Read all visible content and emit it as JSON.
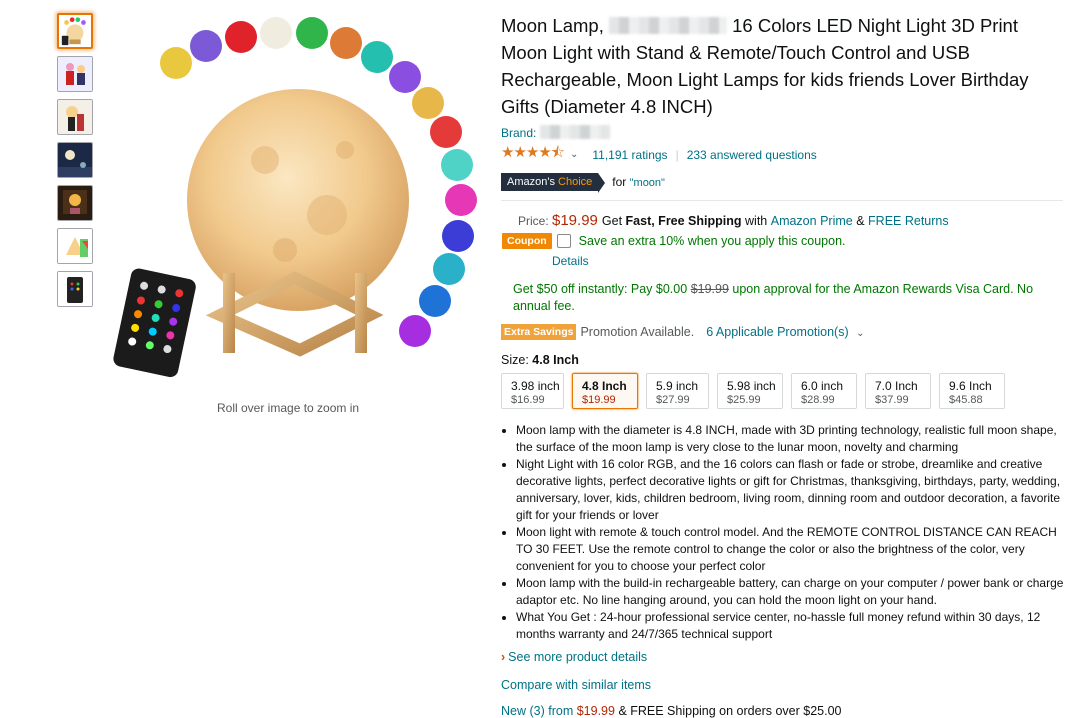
{
  "product": {
    "title_part1": "Moon Lamp,",
    "title_part2": "16 Colors LED Night Light 3D Print Moon Light with Stand & Remote/Touch Control and USB Rechargeable, Moon Light Lamps for kids friends Lover Birthday Gifts (Diameter 4.8 INCH)",
    "brand_label": "Brand:",
    "rating_stars": "★★★★⯪",
    "ratings_count": "11,191 ratings",
    "answered_questions": "233 answered questions",
    "choice_badge_1": "Amazon's",
    "choice_badge_2": "Choice",
    "choice_for": "for",
    "choice_query": "\"moon\""
  },
  "gallery": {
    "zoom_hint": "Roll over image to zoom in",
    "thumbnail_count": 7
  },
  "price": {
    "label": "Price:",
    "amount": "$19.99",
    "get": "Get",
    "shipping": "Fast, Free Shipping",
    "with": "with",
    "prime": "Amazon Prime",
    "amp": "&",
    "returns": "FREE Returns"
  },
  "coupon": {
    "tag": "Coupon",
    "text": "Save an extra 10% when you apply this coupon.",
    "details": "Details"
  },
  "visa": {
    "text_1": "Get $50 off instantly: Pay $0.00",
    "strike": "$19.99",
    "text_2": "upon approval for the Amazon Rewards Visa Card. No annual fee."
  },
  "promo": {
    "tag": "Extra Savings",
    "available": "Promotion Available.",
    "link": "6 Applicable Promotion(s)"
  },
  "size": {
    "label": "Size:",
    "selected": "4.8 Inch",
    "options": [
      {
        "name": "3.98 inch",
        "price": "$16.99"
      },
      {
        "name": "4.8 Inch",
        "price": "$19.99"
      },
      {
        "name": "5.9 inch",
        "price": "$27.99"
      },
      {
        "name": "5.98 inch",
        "price": "$25.99"
      },
      {
        "name": "6.0 inch",
        "price": "$28.99"
      },
      {
        "name": "7.0 Inch",
        "price": "$37.99"
      },
      {
        "name": "9.6 Inch",
        "price": "$45.88"
      }
    ]
  },
  "bullets": [
    "Moon lamp with the diameter is 4.8 INCH, made with 3D printing technology, realistic full moon shape, the surface of the moon lamp is very close to the lunar moon, novelty and charming",
    "Night Light with 16 color RGB, and the 16 colors can flash or fade or strobe, dreamlike and creative decorative lights, perfect decorative lights or gift for Christmas, thanksgiving, birthdays, party, wedding, anniversary, lover, kids, children bedroom, living room, dinning room and outdoor decoration, a favorite gift for your friends or lover",
    "Moon light with remote & touch control model. And the REMOTE CONTROL DISTANCE CAN REACH TO 30 FEET. Use the remote control to change the color or also the brightness of the color, very convenient for you to choose your perfect color",
    "Moon lamp with the build-in rechargeable battery, can charge on your computer / power bank or charge adaptor etc. No line hanging around, you can hold the moon light on your hand.",
    "What You Get : 24-hour professional service center, no-hassle full money refund within 30 days, 12 months warranty and 24/7/365 technical support"
  ],
  "links": {
    "see_more": "See more product details",
    "compare": "Compare with similar items",
    "new_offers": "New (3) from",
    "new_price": "$19.99",
    "new_shipping": "& FREE Shipping on orders over $25.00"
  },
  "colors": {
    "link": "#007185",
    "price": "#B12704",
    "green": "#007600",
    "star": "#de7921",
    "badge_bg": "#232f3e",
    "coupon": "#f08804"
  }
}
